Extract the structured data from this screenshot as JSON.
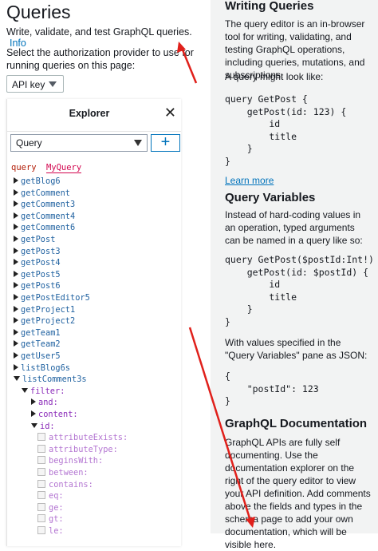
{
  "header": {
    "title": "Queries",
    "subtitle": "Write, validate, and test GraphQL queries.",
    "info_link": "Info"
  },
  "auth": {
    "description": "Select the authorization provider to use for running queries on this page:",
    "selected": "API key"
  },
  "explorer": {
    "title": "Explorer",
    "operation_type": "Query",
    "add_label": "+",
    "query_keyword": "query",
    "query_name": "MyQuery",
    "fields": [
      "getBlog6",
      "getComment",
      "getComment3",
      "getComment4",
      "getComment6",
      "getPost",
      "getPost3",
      "getPost4",
      "getPost5",
      "getPost6",
      "getPostEditor5",
      "getProject1",
      "getProject2",
      "getTeam1",
      "getTeam2",
      "getUser5",
      "listBlog6s"
    ],
    "expanded_field": "listComment3s",
    "filter_label": "filter:",
    "and_label": "and:",
    "content_label": "content:",
    "id_label": "id:",
    "id_ops": [
      "attributeExists:",
      "attributeType:",
      "beginsWith:",
      "between:",
      "contains:",
      "eq:",
      "ge:",
      "gt:",
      "le:"
    ]
  },
  "docs": {
    "writing_title": "Writing Queries",
    "writing_body": "The query editor is an in-browser tool for writing, validating, and testing GraphQL operations, including queries, mutations, and subscriptions.",
    "example_intro": "A query might look like:",
    "example_code": "query GetPost {\n    getPost(id: 123) {\n        id\n        title\n    }\n}",
    "learn_more": "Learn more",
    "variables_title": "Query Variables",
    "variables_body": "Instead of hard-coding values in an operation, typed arguments can be named in a query like so:",
    "variables_code": "query GetPost($postId:Int!) {\n    getPost(id: $postId) {\n        id\n        title\n    }\n}",
    "json_intro": "With values specified in the \"Query Variables\" pane as JSON:",
    "json_code": "{\n    \"postId\": 123\n}",
    "docs_title": "GraphQL Documentation",
    "docs_body": "GraphQL APIs are fully self documenting. Use the documentation explorer on the right of the query editor to view your API definition. Add comments above the fields and types in the schema page to add your own documentation, which will be visible here."
  },
  "colors": {
    "accent": "#0073bb",
    "annotation_arrow": "#e0201b"
  }
}
